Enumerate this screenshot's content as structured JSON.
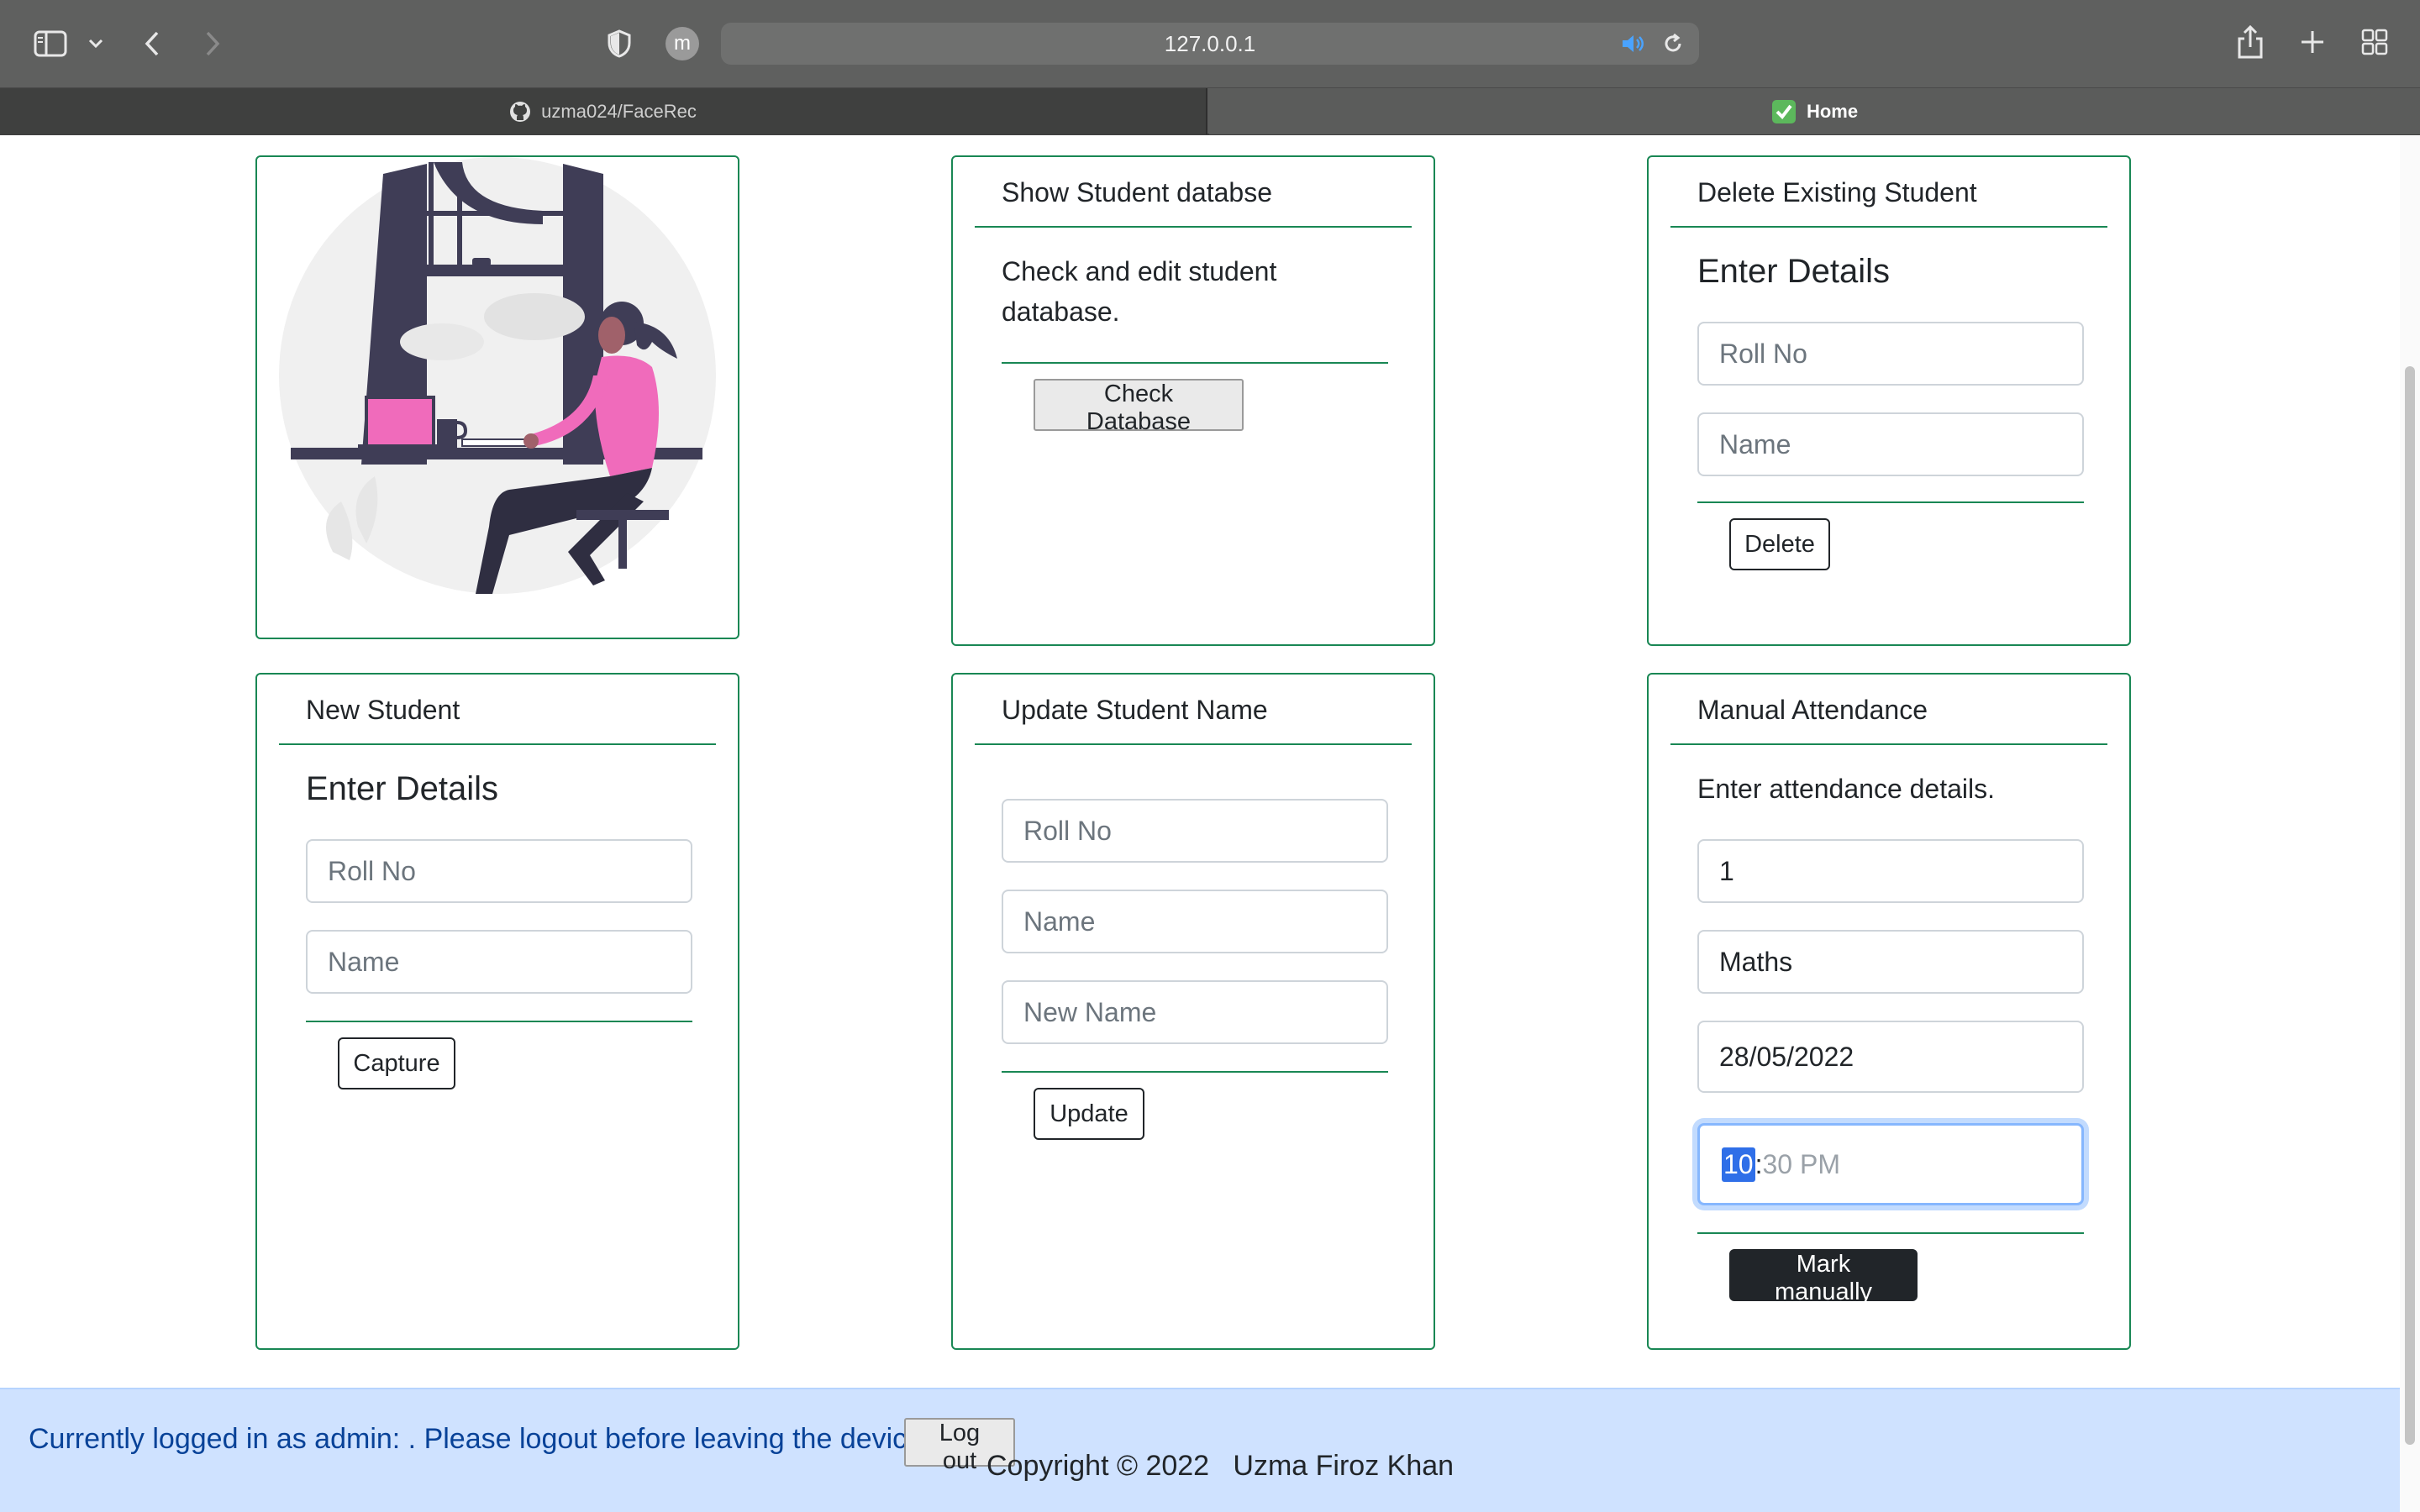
{
  "browser": {
    "url": "127.0.0.1",
    "profile_initial": "m",
    "tabs": [
      {
        "label": "uzma024/FaceRec",
        "icon": "github-icon"
      },
      {
        "label": "Home",
        "icon": "checkmark-icon"
      }
    ]
  },
  "cards": {
    "show_db": {
      "header": "Show Student databse",
      "text": "Check and edit student database.",
      "button": "Check Database"
    },
    "delete_student": {
      "header": "Delete Existing Student",
      "title": "Enter Details",
      "roll_placeholder": "Roll No",
      "name_placeholder": "Name",
      "button": "Delete"
    },
    "new_student": {
      "header": "New Student",
      "title": "Enter Details",
      "roll_placeholder": "Roll No",
      "name_placeholder": "Name",
      "button": "Capture"
    },
    "update_name": {
      "header": "Update Student Name",
      "roll_placeholder": "Roll No",
      "name_placeholder": "Name",
      "new_name_placeholder": "New Name",
      "button": "Update"
    },
    "manual_attendance": {
      "header": "Manual Attendance",
      "text": "Enter attendance details.",
      "roll_value": "1",
      "subject_value": "Maths",
      "date_value": "28/05/2022",
      "time_hour": "10",
      "time_sep": ":",
      "time_rest": "30 PM",
      "button": "Mark manually"
    }
  },
  "footer": {
    "message": "Currently logged in as admin: . Please logout before leaving the device.",
    "logout_button": "Log out",
    "copyright": "Copyright © 2022   Uzma Firoz Khan"
  },
  "colors": {
    "card_border": "#198754",
    "footer_bg": "#cfe2ff",
    "footer_text": "#084298",
    "illustration_accent": "#f06bbb"
  }
}
